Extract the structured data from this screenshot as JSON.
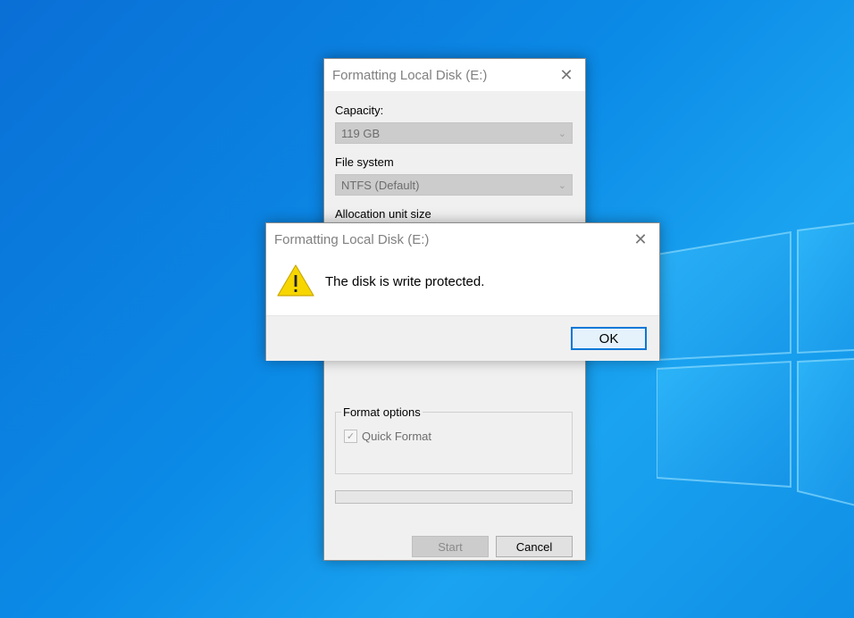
{
  "colors": {
    "desktop": "#0b8ae6",
    "accent": "#0078d7",
    "warning": "#f7d600"
  },
  "format_dialog": {
    "title": "Formatting Local Disk (E:)",
    "capacity_label": "Capacity:",
    "capacity_value": "119 GB",
    "filesystem_label": "File system",
    "filesystem_value": "NTFS (Default)",
    "allocation_label": "Allocation unit size",
    "format_options_label": "Format options",
    "quick_format_label": "Quick Format",
    "quick_format_checked": true,
    "start_label": "Start",
    "cancel_label": "Cancel"
  },
  "alert_dialog": {
    "title": "Formatting Local Disk (E:)",
    "icon": "warning-icon",
    "message": "The disk is write protected.",
    "ok_label": "OK"
  }
}
